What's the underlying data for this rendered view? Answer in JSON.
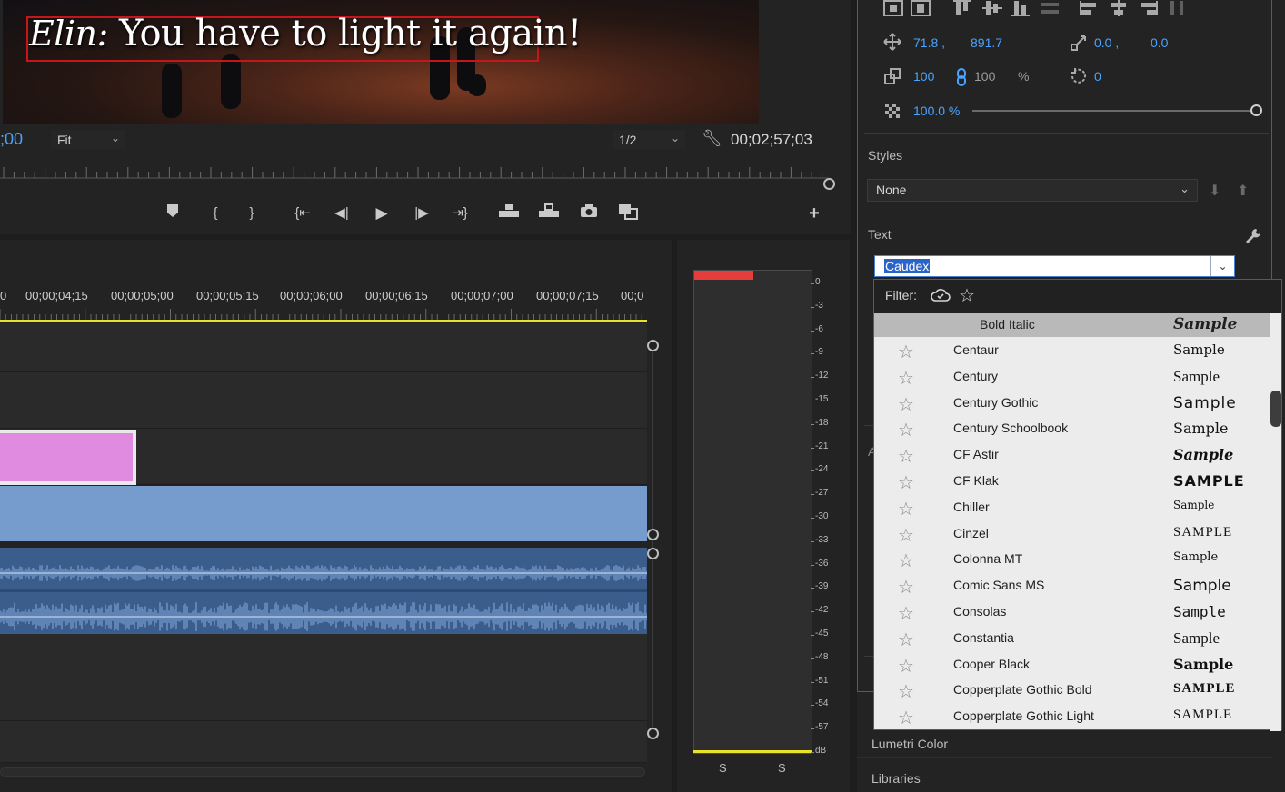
{
  "monitor": {
    "caption_speaker": "Elin:",
    "caption_line": "You have to light it again!",
    "timecode_left": ";00",
    "fit": "Fit",
    "resolution": "1/2",
    "duration": "00;02;57;03"
  },
  "transport": {
    "buttons": [
      "marker",
      "in-point",
      "out-point",
      "go-to-in",
      "step-back",
      "play",
      "step-forward",
      "go-to-out",
      "lift",
      "extract",
      "export-frame",
      "comparison-view",
      "add"
    ]
  },
  "timeline": {
    "ruler_labels": [
      "0",
      "00;00;04;15",
      "00;00;05;00",
      "00;00;05;15",
      "00;00;06;00",
      "00;00;06;15",
      "00;00;07;00",
      "00;00;07;15",
      "00;0"
    ]
  },
  "meter": {
    "db_scale": [
      "0",
      "-3",
      "-6",
      "-9",
      "-12",
      "-15",
      "-18",
      "-21",
      "-24",
      "-27",
      "-30",
      "-33",
      "-36",
      "-39",
      "-42",
      "-45",
      "-48",
      "-51",
      "-54",
      "-57",
      "dB"
    ],
    "solo_left": "S",
    "solo_right": "S"
  },
  "essential_graphics": {
    "position_x": "71.8 ,",
    "position_y": "891.7",
    "anchor_x": "0.0 ,",
    "anchor_y": "0.0",
    "scale_w": "100",
    "scale_h": "100",
    "scale_unit": "%",
    "rotation": "0",
    "opacity": "100.0 %",
    "opacity_level": 1.0,
    "styles_label": "Styles",
    "styles_value": "None",
    "text_label": "Text",
    "font_value": "Caudex",
    "hidden_letter": "A"
  },
  "font_dropdown": {
    "filter_label": "Filter:",
    "header_style": "Bold Italic",
    "header_sample": "Sample",
    "fonts": [
      {
        "name": "Centaur",
        "sample": "Sample"
      },
      {
        "name": "Century",
        "sample": "Sample"
      },
      {
        "name": "Century Gothic",
        "sample": "Sample"
      },
      {
        "name": "Century Schoolbook",
        "sample": "Sample"
      },
      {
        "name": "CF Astir",
        "sample": "Sample"
      },
      {
        "name": "CF Klak",
        "sample": "SAMPLE"
      },
      {
        "name": "Chiller",
        "sample": "Sample"
      },
      {
        "name": "Cinzel",
        "sample": "SAMPLE"
      },
      {
        "name": "Colonna MT",
        "sample": "Sample"
      },
      {
        "name": "Comic Sans MS",
        "sample": "Sample"
      },
      {
        "name": "Consolas",
        "sample": "Sample"
      },
      {
        "name": "Constantia",
        "sample": "Sample"
      },
      {
        "name": "Cooper Black",
        "sample": "Sample"
      },
      {
        "name": "Copperplate Gothic Bold",
        "sample": "SAMPLE"
      },
      {
        "name": "Copperplate Gothic Light",
        "sample": "SAMPLE"
      }
    ]
  },
  "panels": {
    "lumetri": "Lumetri Color",
    "libraries": "Libraries"
  },
  "colors": {
    "accent_blue": "#4aa3ff",
    "clip_pink": "#e08ae0",
    "clip_blue": "#769ccd",
    "audio_blue": "#3a5d8c",
    "work_area_yellow": "#e8e32a",
    "peak_red": "#e53c3c"
  }
}
